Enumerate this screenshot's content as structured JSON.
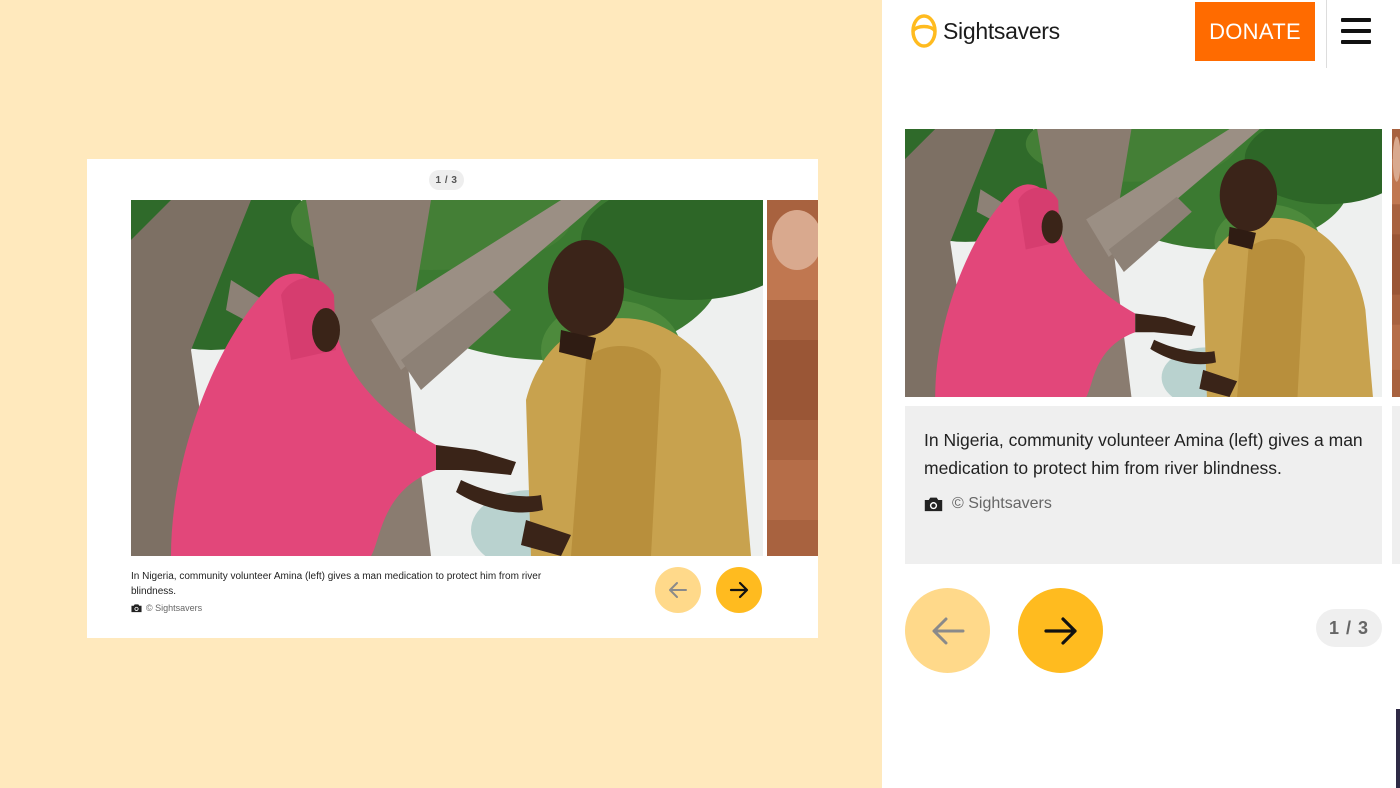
{
  "desktop": {
    "counter": "1 / 3",
    "caption": "In Nigeria, community volunteer Amina (left) gives a man medication to protect him from river blindness.",
    "credit": "© Sightsavers",
    "prev_icon": "arrow-left-icon",
    "next_icon": "arrow-right-icon"
  },
  "mobile": {
    "header": {
      "logo_text": "Sightsavers",
      "logo_icon": "sightsavers-logo-icon",
      "donate_label": "DONATE",
      "menu_icon": "hamburger-menu-icon"
    },
    "caption": "In Nigeria, community volunteer Amina (left) gives a man medication to protect him from river blindness.",
    "credit": "© Sightsavers",
    "counter": "1 / 3",
    "prev_icon": "arrow-left-icon",
    "next_icon": "arrow-right-icon"
  },
  "colors": {
    "page_background": "#ffe9bd",
    "accent_yellow": "#ffbb1f",
    "disabled_yellow": "#ffd98a",
    "donate_orange": "#ff6b00",
    "caption_background": "#efefef"
  }
}
